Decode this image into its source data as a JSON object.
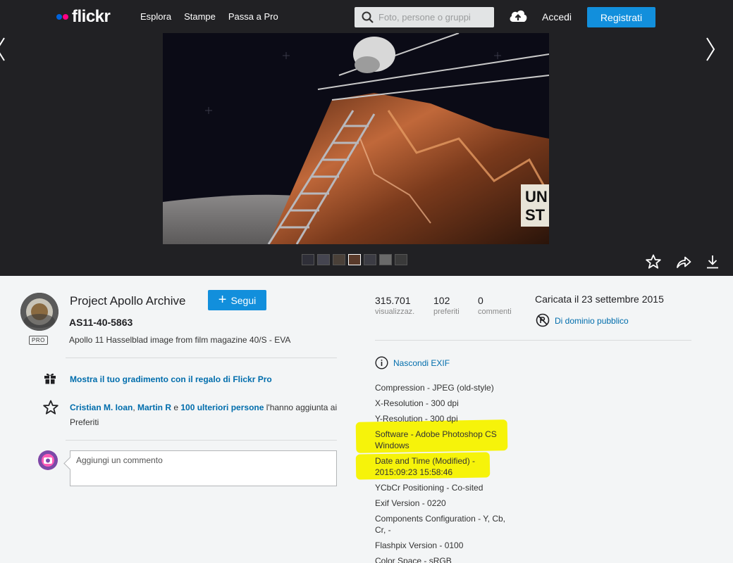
{
  "header": {
    "logo": "flickr",
    "nav": [
      "Esplora",
      "Stampe",
      "Passa a Pro"
    ],
    "search_placeholder": "Foto, persone o gruppi",
    "login": "Accedi",
    "signup": "Registrati",
    "colors": {
      "accent": "#128fdc",
      "logo_blue": "#0063dc",
      "logo_pink": "#ff0084"
    }
  },
  "photo": {
    "thumbnails_count": 7,
    "active_thumbnail_index": 3
  },
  "owner": {
    "name": "Project Apollo Archive",
    "badge": "PRO",
    "follow_label": "Segui"
  },
  "photo_info": {
    "title": "AS11-40-5863",
    "description": "Apollo 11 Hasselblad image from film magazine 40/S - EVA"
  },
  "gift": {
    "text": "Mostra il tuo gradimento con il regalo di Flickr Pro"
  },
  "faves": {
    "user1": "Cristian M. Ioan",
    "sep1": ", ",
    "user2": "Martin R",
    "sep2": " e ",
    "others": "100 ulteriori persone",
    "suffix": " l'hanno aggiunta ai Preferiti"
  },
  "comment": {
    "placeholder": "Aggiungi un commento"
  },
  "stats": [
    {
      "value": "315.701",
      "label": "visualizzaz."
    },
    {
      "value": "102",
      "label": "preferiti"
    },
    {
      "value": "0",
      "label": "commenti"
    }
  ],
  "uploaded": "Caricata il 23 settembre 2015",
  "license": "Di dominio pubblico",
  "exif": {
    "toggle_label": "Nascondi EXIF",
    "rows": [
      "Compression - JPEG (old-style)",
      "X-Resolution - 300 dpi",
      "Y-Resolution - 300 dpi",
      "Software - Adobe Photoshop CS Windows",
      "Date and Time (Modified) - 2015:09:23 15:58:46",
      "YCbCr Positioning - Co-sited",
      "Exif Version - 0220",
      "Components Configuration - Y, Cb, Cr, -",
      "Flashpix Version - 0100",
      "Color Space - sRGB"
    ],
    "highlight_color": "#f6f30a"
  }
}
